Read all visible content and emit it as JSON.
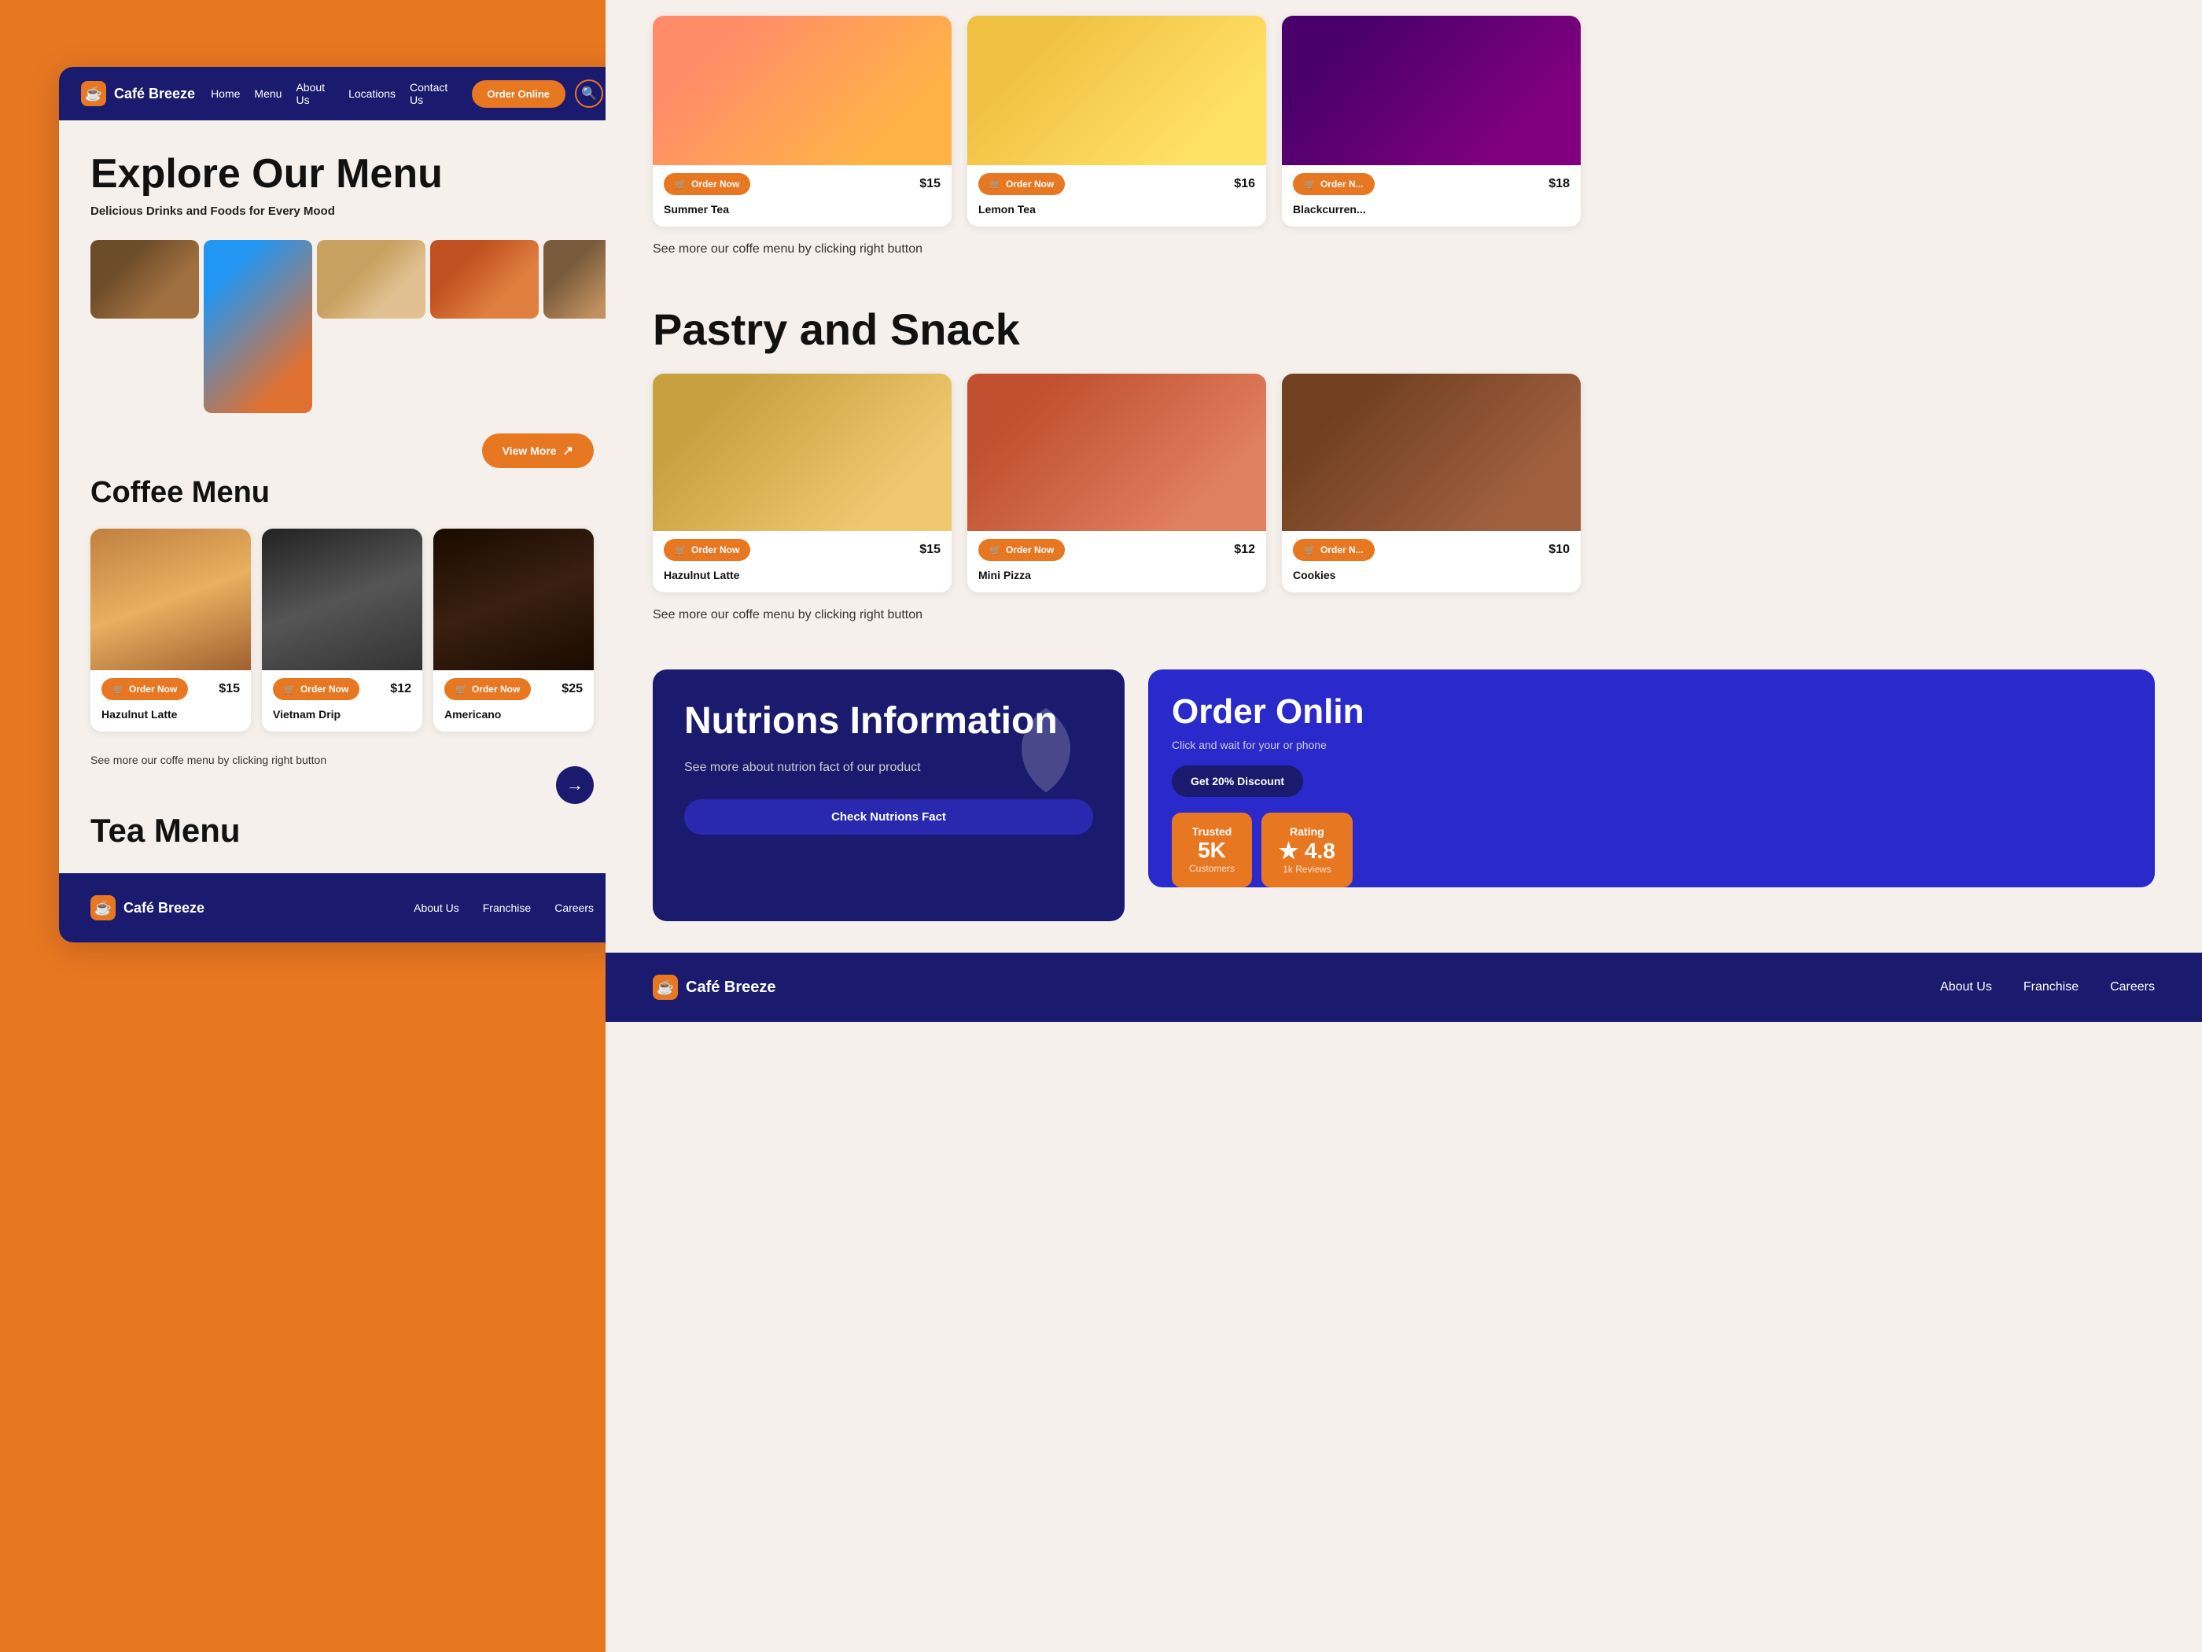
{
  "brand": {
    "name": "Café Breeze",
    "icon": "☕"
  },
  "navbar": {
    "links": [
      "Home",
      "Menu",
      "About Us",
      "Locations",
      "Contact Us"
    ],
    "order_button": "Order Online",
    "search_icon": "🔍"
  },
  "hero": {
    "title": "Explore Our Menu",
    "subtitle": "Delicious Drinks and Foods for Every Mood",
    "view_more": "View More"
  },
  "coffee_section": {
    "title": "Coffee Menu",
    "items": [
      {
        "name": "Hazulnut Latte",
        "price": "$15",
        "order_label": "Order Now"
      },
      {
        "name": "Vietnam Drip",
        "price": "$12",
        "order_label": "Order Now"
      },
      {
        "name": "Americano",
        "price": "$25",
        "order_label": "Order Now"
      }
    ],
    "see_more": "See more our coffe menu by clicking right button"
  },
  "tea_section": {
    "title": "Tea Menu",
    "items": [
      {
        "name": "Summer Tea",
        "price": "$15",
        "order_label": "Order Now"
      },
      {
        "name": "Lemon Tea",
        "price": "$16",
        "order_label": "Order Now"
      },
      {
        "name": "Blackcurren...",
        "price": "$18",
        "order_label": "Order N..."
      }
    ],
    "see_more": "See more our coffe menu by clicking right button"
  },
  "pastry_section": {
    "title": "Pastry and Snack",
    "items": [
      {
        "name": "Hazulnut Latte",
        "price": "$15",
        "order_label": "Order Now"
      },
      {
        "name": "Mini Pizza",
        "price": "$12",
        "order_label": "Order Now"
      },
      {
        "name": "Cookies",
        "price": "$10",
        "order_label": "Order N..."
      }
    ],
    "see_more": "See more our coffe menu by clicking right button"
  },
  "nutrition": {
    "title": "Nutrions Information",
    "description": "See more about nutrion fact of our product",
    "button_label": "Check Nutrions Fact"
  },
  "order_online": {
    "title": "Order Onlin",
    "description": "Click and wait for your or phone",
    "discount_button": "Get 20% Discount",
    "stats": [
      {
        "label": "Trusted",
        "value": "5K",
        "sub": "Customers"
      },
      {
        "label": "Rating",
        "value": "★ 4.8",
        "sub": "1k Reviews"
      }
    ]
  },
  "footer": {
    "brand": "Café Breeze",
    "links": [
      "About Us",
      "Franchise",
      "Careers"
    ]
  }
}
